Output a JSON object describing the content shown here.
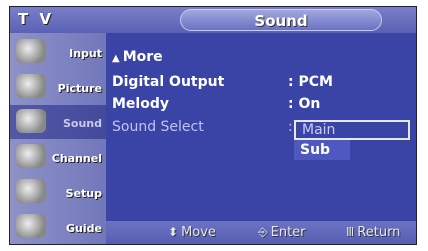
{
  "header": {
    "tv_label": "T V",
    "title": "Sound"
  },
  "sidebar": {
    "items": [
      {
        "label": "Input",
        "icon": "input-icon"
      },
      {
        "label": "Picture",
        "icon": "picture-icon"
      },
      {
        "label": "Sound",
        "icon": "sound-icon",
        "active": true
      },
      {
        "label": "Channel",
        "icon": "channel-icon"
      },
      {
        "label": "Setup",
        "icon": "setup-icon"
      },
      {
        "label": "Guide",
        "icon": "guide-icon"
      }
    ]
  },
  "menu": {
    "more_label": "More",
    "rows": [
      {
        "name": "Digital Output",
        "value": ": PCM"
      },
      {
        "name": "Melody",
        "value": ": On"
      },
      {
        "name": "Sound Select",
        "value": ":"
      }
    ],
    "dropdown": {
      "selected": "Main",
      "options": [
        "Main",
        "Sub"
      ]
    }
  },
  "footer": {
    "move": "Move",
    "enter": "Enter",
    "return": "Return"
  },
  "colors": {
    "background": "#3a44a6",
    "sidebar": "#7f84c2",
    "highlight": "#4e58c0"
  }
}
